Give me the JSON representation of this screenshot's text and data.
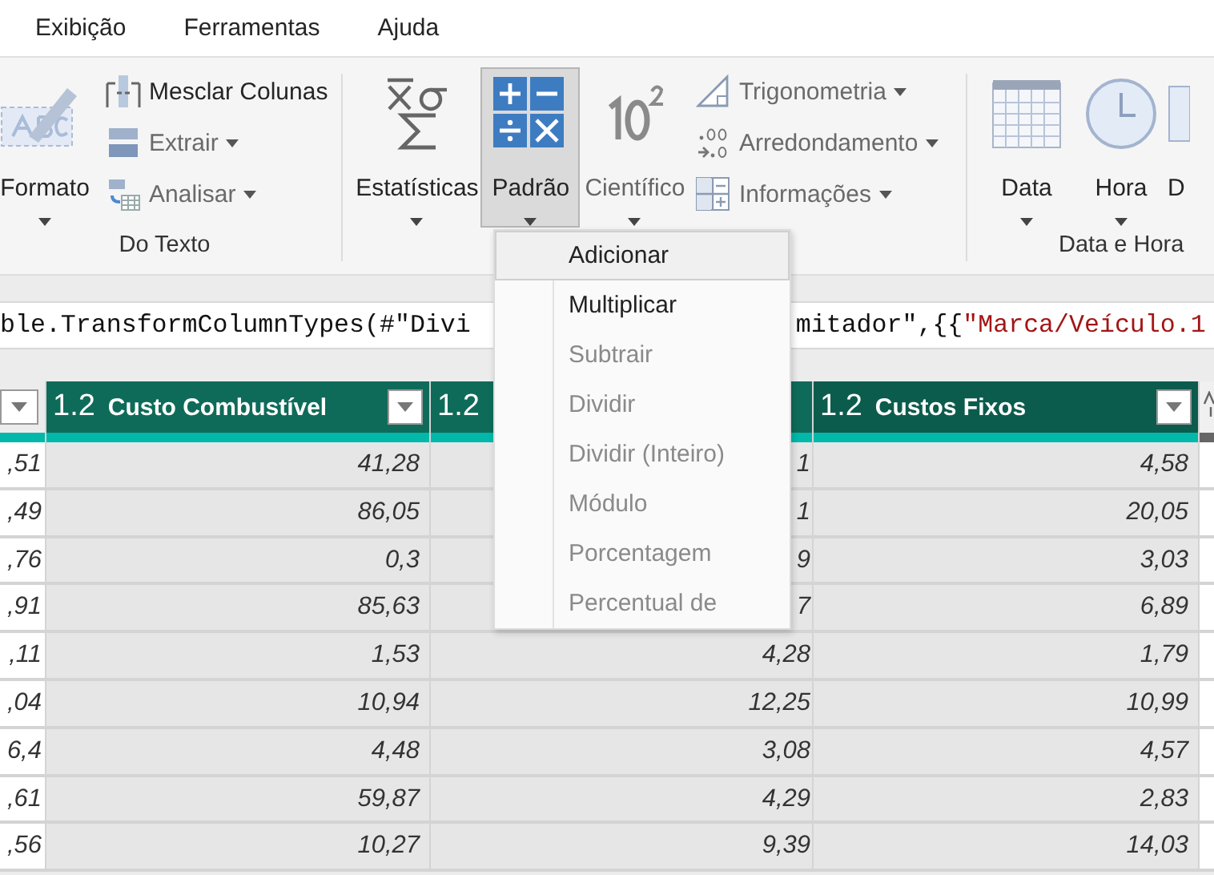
{
  "menu_tabs": [
    {
      "label": "Exibição"
    },
    {
      "label": "Ferramentas"
    },
    {
      "label": "Ajuda"
    }
  ],
  "ribbon": {
    "text_group": {
      "label": "Do Texto",
      "format": {
        "label": "Formato",
        "disabled": false
      },
      "small": [
        {
          "label": "Mesclar Colunas",
          "dropdown": false,
          "disabled": false
        },
        {
          "label": "Extrair",
          "dropdown": true,
          "disabled": true
        },
        {
          "label": "Analisar",
          "dropdown": true,
          "disabled": true
        }
      ]
    },
    "number_group": {
      "large": [
        {
          "label": "Estatísticas",
          "selected": false,
          "disabled": false
        },
        {
          "label": "Padrão",
          "selected": true,
          "disabled": false
        },
        {
          "label": "Científico",
          "selected": false,
          "disabled": true
        }
      ],
      "small": [
        {
          "label": "Trigonometria",
          "dropdown": true,
          "disabled": true
        },
        {
          "label": "Arredondamento",
          "dropdown": true,
          "disabled": true
        },
        {
          "label": "Informações",
          "dropdown": true,
          "disabled": true
        }
      ]
    },
    "date_group": {
      "label": "Data e Hora",
      "large": [
        {
          "label": "Data",
          "disabled": false
        },
        {
          "label": "Hora",
          "disabled": false
        },
        {
          "label": "D",
          "disabled": false
        }
      ]
    }
  },
  "formula": {
    "left": [
      {
        "text": "ble.TransformColumnTypes(#\"Divi",
        "kind": "code"
      }
    ],
    "right": [
      {
        "text": "mitador\",{{",
        "kind": "code"
      },
      {
        "text": "\"Marca/Veículo.1",
        "kind": "string"
      }
    ]
  },
  "table": {
    "columns": [
      {},
      {
        "type_label": "1.2",
        "name": "Custo Combustível"
      },
      {
        "type_label": "1.2"
      },
      {
        "type_label": "1.2",
        "name": "Custos Fixos"
      }
    ],
    "rows": [
      [
        ",51",
        "41,28",
        "1",
        "4,58"
      ],
      [
        ",49",
        "86,05",
        "1",
        "20,05"
      ],
      [
        ",76",
        "0,3",
        "9",
        "3,03"
      ],
      [
        ",91",
        "85,63",
        "7",
        "6,89"
      ],
      [
        ",11",
        "1,53",
        "4,28",
        "1,79"
      ],
      [
        ",04",
        "10,94",
        "12,25",
        "10,99"
      ],
      [
        "6,4",
        "4,48",
        "3,08",
        "4,57"
      ],
      [
        ",61",
        "59,87",
        "4,29",
        "2,83"
      ],
      [
        ",56",
        "10,27",
        "9,39",
        "14,03"
      ]
    ]
  },
  "dropdown_menu": {
    "items": [
      {
        "label": "Adicionar",
        "highlighted": true,
        "disabled": false
      },
      {
        "label": "Multiplicar",
        "highlighted": false,
        "disabled": false
      },
      {
        "label": "Subtrair",
        "highlighted": false,
        "disabled": true
      },
      {
        "label": "Dividir",
        "highlighted": false,
        "disabled": true
      },
      {
        "label": "Dividir (Inteiro)",
        "highlighted": false,
        "disabled": true
      },
      {
        "label": "Módulo",
        "highlighted": false,
        "disabled": true
      },
      {
        "label": "Porcentagem",
        "highlighted": false,
        "disabled": true
      },
      {
        "label": "Percentual de",
        "highlighted": false,
        "disabled": true
      }
    ]
  }
}
